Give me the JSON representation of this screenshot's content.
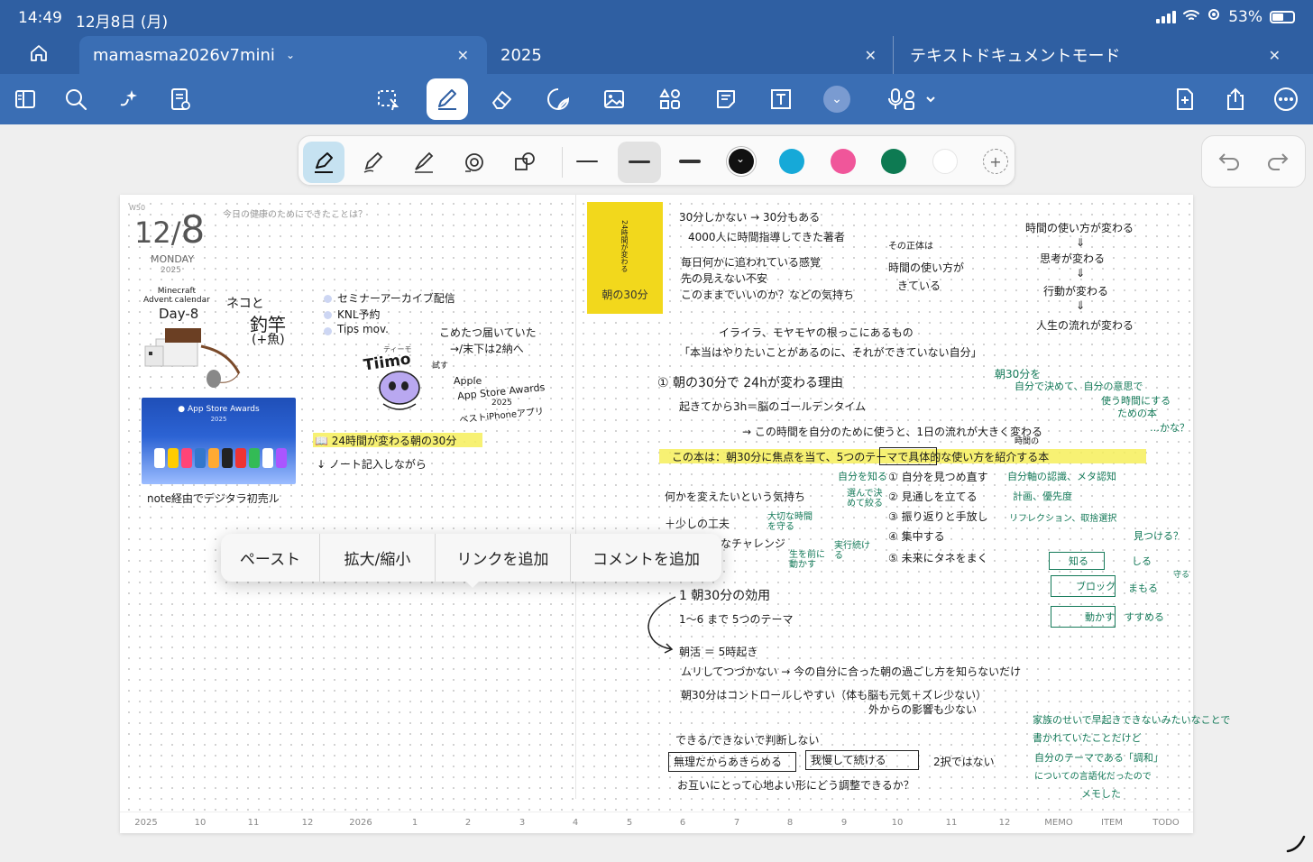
{
  "status": {
    "time": "14:49",
    "date": "12月8日 (月)",
    "battery": "53%"
  },
  "tabs": [
    {
      "label": "mamasma2026v7mini"
    },
    {
      "label": "2025"
    },
    {
      "label": "テキストドキュメントモード"
    }
  ],
  "page_header": {
    "week": "W50",
    "month": "12/",
    "day": "8",
    "weekday": "MONDAY",
    "year": "2025",
    "prompt": "今日の健康のためにできたことは？"
  },
  "left_notes": {
    "minecraft_label_1": "Minecraft",
    "minecraft_label_2": "Advent calendar",
    "minecraft_day": "Day-8",
    "nekoto": "ネコと",
    "tsurizao": "釣竿",
    "sakana": "(+魚)",
    "asa_title": "App Store Awards",
    "asa_year": "2025",
    "note_line": "note経由でデジタラ初売ル"
  },
  "mid_notes": {
    "bullets": [
      "セミナーアーカイブ配信",
      "KNL予約",
      "Tips mov."
    ],
    "kotatsu_1": "こめたつ届いていた",
    "kotatsu_2": "→/末下は2納へ",
    "tiimo_small": "ティーモ",
    "tiimo": "Tiimo",
    "tiimo_note": "試す",
    "apple_1": "Apple",
    "apple_2": "App Store Awards",
    "apple_3": "2025",
    "apple_4": "ベストiPhoneアプリ",
    "book_line": "24時間が変わる朝の30分",
    "note_record": "ノート記入しながら"
  },
  "book": {
    "vertical": "24時間が変わる",
    "title": "朝の30分"
  },
  "right_notes": {
    "l1": "30分しかない → 30分もある",
    "l2": "4000人に時間指導してきた著者",
    "l3": "毎日何かに追われている感覚",
    "l4": "先の見えない不安",
    "l5": "このままでいいのか？などの気持ち",
    "l6": "その正体は",
    "l7": "時間の使い方が",
    "l8": "きている",
    "l9": "イライラ、モヤモヤの根っこにあるもの",
    "l10": "「本当はやりたいことがあるのに、それができていない自分」",
    "l11": "① 朝の30分で 24hが変わる理由",
    "l12": "起きてから3h＝脳のゴールデンタイム",
    "l13": "→ この時間を自分のために使うと、1日の流れが大きく変わる",
    "l13b": "時間の",
    "l14": "この本は：朝30分に焦点を当て、5つのテーマで具体的な使い方を紹介する本",
    "l15": "何かを変えたいという気持ち",
    "l16": "＋少しの工夫",
    "l17": "なチャレンジ",
    "l18": "① 自分を見つめ直す",
    "l19": "② 見通しを立てる",
    "l20": "③ 振り返りと手放し",
    "l21": "④ 集中する",
    "l22": "⑤ 未来にタネをまく",
    "l23": "1 朝30分の効用",
    "l24": "1〜6 まで 5つのテーマ",
    "l25": "朝活 ＝ 5時起き",
    "l26": "ムリしてつづかない → 今の自分に合った朝の過ごし方を知らないだけ",
    "l27": "朝30分はコントロールしやすい（体も脳も元気＋ズレ少ない）",
    "l28": "外からの影響も少ない",
    "l29": "できる/できないで判断しない",
    "l30": "無理だからあきらめる",
    "l31": "我慢して続ける",
    "l32": "2択ではない",
    "l33": "お互いにとって心地よい形にどう調整できるか？",
    "r1": "時間の使い方が変わる",
    "r2": "思考が変わる",
    "r3": "行動が変わる",
    "r4": "人生の流れが変わる"
  },
  "green_notes": {
    "g1": "朝30分を",
    "g2": "自分で決めて、自分の意思で",
    "g3": "使う時間にする",
    "g4": "ための本",
    "g5": "…かな？",
    "g6": "自分を知る",
    "g7": "自分軸の認識、メタ認知",
    "g8": "計画、優先度",
    "g9": "選んで決めて絞る",
    "g10": "リフレクション、取捨選択",
    "g11": "大切な時間を守る",
    "g12": "生を前に動かす",
    "g13": "実行続ける",
    "g14": "見つける？",
    "g15": "知る",
    "g16": "しる",
    "g17": "ブロック",
    "g18": "まもる",
    "g19": "守る",
    "g20": "動かす",
    "g21": "すすめる",
    "g22": "家族のせいで早起きできないみたいなことで",
    "g23": "書かれていたことだけど",
    "g24": "自分のテーマである「調和」",
    "g25": "についての言語化だったので",
    "g26": "メモした"
  },
  "context_menu": [
    "ペースト",
    "拡大/縮小",
    "リンクを追加",
    "コメントを追加"
  ],
  "footer": [
    "2025",
    "10",
    "11",
    "12",
    "2026",
    "1",
    "2",
    "3",
    "4",
    "5",
    "6",
    "7",
    "8",
    "9",
    "10",
    "11",
    "12",
    "MEMO",
    "ITEM",
    "TODO"
  ],
  "colors": {
    "chrome": "#2f5fa2",
    "toolbar": "#3a6eb4",
    "ink": "#1a1a1a",
    "green_ink": "#147a59",
    "highlight": "#f6ef5b",
    "swatches": [
      "#111111",
      "#16a9d8",
      "#f0569a",
      "#0d7a52",
      "#ffffff"
    ]
  }
}
